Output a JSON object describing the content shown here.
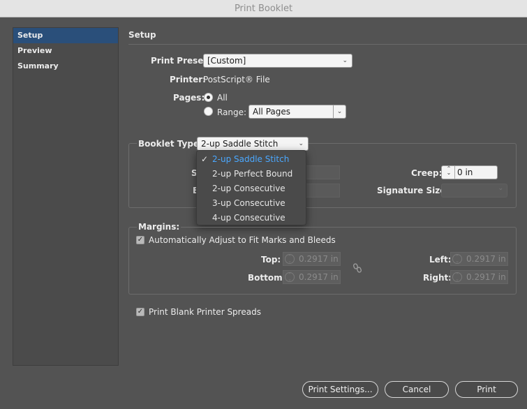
{
  "window": {
    "title": "Print Booklet"
  },
  "sidebar": {
    "items": [
      {
        "label": "Setup",
        "active": true
      },
      {
        "label": "Preview",
        "active": false
      },
      {
        "label": "Summary",
        "active": false
      }
    ]
  },
  "setup": {
    "section_title": "Setup",
    "print_preset": {
      "label": "Print Preset:",
      "value": "[Custom]"
    },
    "printer": {
      "label": "Printer:",
      "value": "PostScript® File"
    },
    "pages": {
      "label": "Pages:",
      "all_label": "All",
      "range_label": "Range:",
      "range_value": "All Pages",
      "selected": "all"
    }
  },
  "booklet": {
    "type_label": "Booklet Type:",
    "type_value": "2-up Saddle Stitch",
    "partial_label_1": "S",
    "partial_label_2": "B",
    "creep_label": "Creep:",
    "creep_value": "0 in",
    "signature_label": "Signature Size:",
    "menu_items": [
      {
        "label": "2-up Saddle Stitch",
        "selected": true
      },
      {
        "label": "2-up Perfect Bound",
        "selected": false
      },
      {
        "label": "2-up Consecutive",
        "selected": false
      },
      {
        "label": "3-up Consecutive",
        "selected": false
      },
      {
        "label": "4-up Consecutive",
        "selected": false
      }
    ]
  },
  "margins": {
    "title": "Margins:",
    "auto_adjust_label": "Automatically Adjust to Fit Marks and Bleeds",
    "auto_adjust_checked": true,
    "top_label": "Top:",
    "bottom_label": "Bottom:",
    "left_label": "Left:",
    "right_label": "Right:",
    "top_value": "0.2917 in",
    "bottom_value": "0.2917 in",
    "left_value": "0.2917 in",
    "right_value": "0.2917 in"
  },
  "print_blank": {
    "label": "Print Blank Printer Spreads",
    "checked": true
  },
  "buttons": {
    "print_settings": "Print Settings...",
    "cancel": "Cancel",
    "print": "Print"
  },
  "icons": {
    "chevron": "chevron-down-icon",
    "check": "checkmark-icon",
    "link": "chain-link-icon",
    "stepper": "stepper-icon"
  }
}
